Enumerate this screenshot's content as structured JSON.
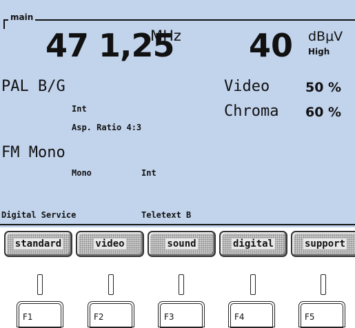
{
  "screen": {
    "frame_label": "main",
    "frequency": {
      "value": "47 1,25",
      "unit": "MHz"
    },
    "level": {
      "value": "40",
      "unit": "dBμV",
      "mode": "High"
    },
    "video_standard": "PAL B/G",
    "video_source": "Int",
    "aspect_ratio": "Asp. Ratio 4:3",
    "video_label": "Video",
    "video_pct": "50 %",
    "chroma_label": "Chroma",
    "chroma_pct": "60 %",
    "sound_mode": "FM Mono",
    "sound_channel": "Mono",
    "sound_source": "Int",
    "digital_service": "Digital Service",
    "teletext": "Teletext B"
  },
  "softkeys": [
    "standard",
    "video",
    "sound",
    "digital",
    "support"
  ],
  "function_keys": [
    "F1",
    "F2",
    "F3",
    "F4",
    "F5"
  ],
  "colors": {
    "lcd_background": "#c2d3ec",
    "softkey_fill": "#c9c9c9"
  }
}
